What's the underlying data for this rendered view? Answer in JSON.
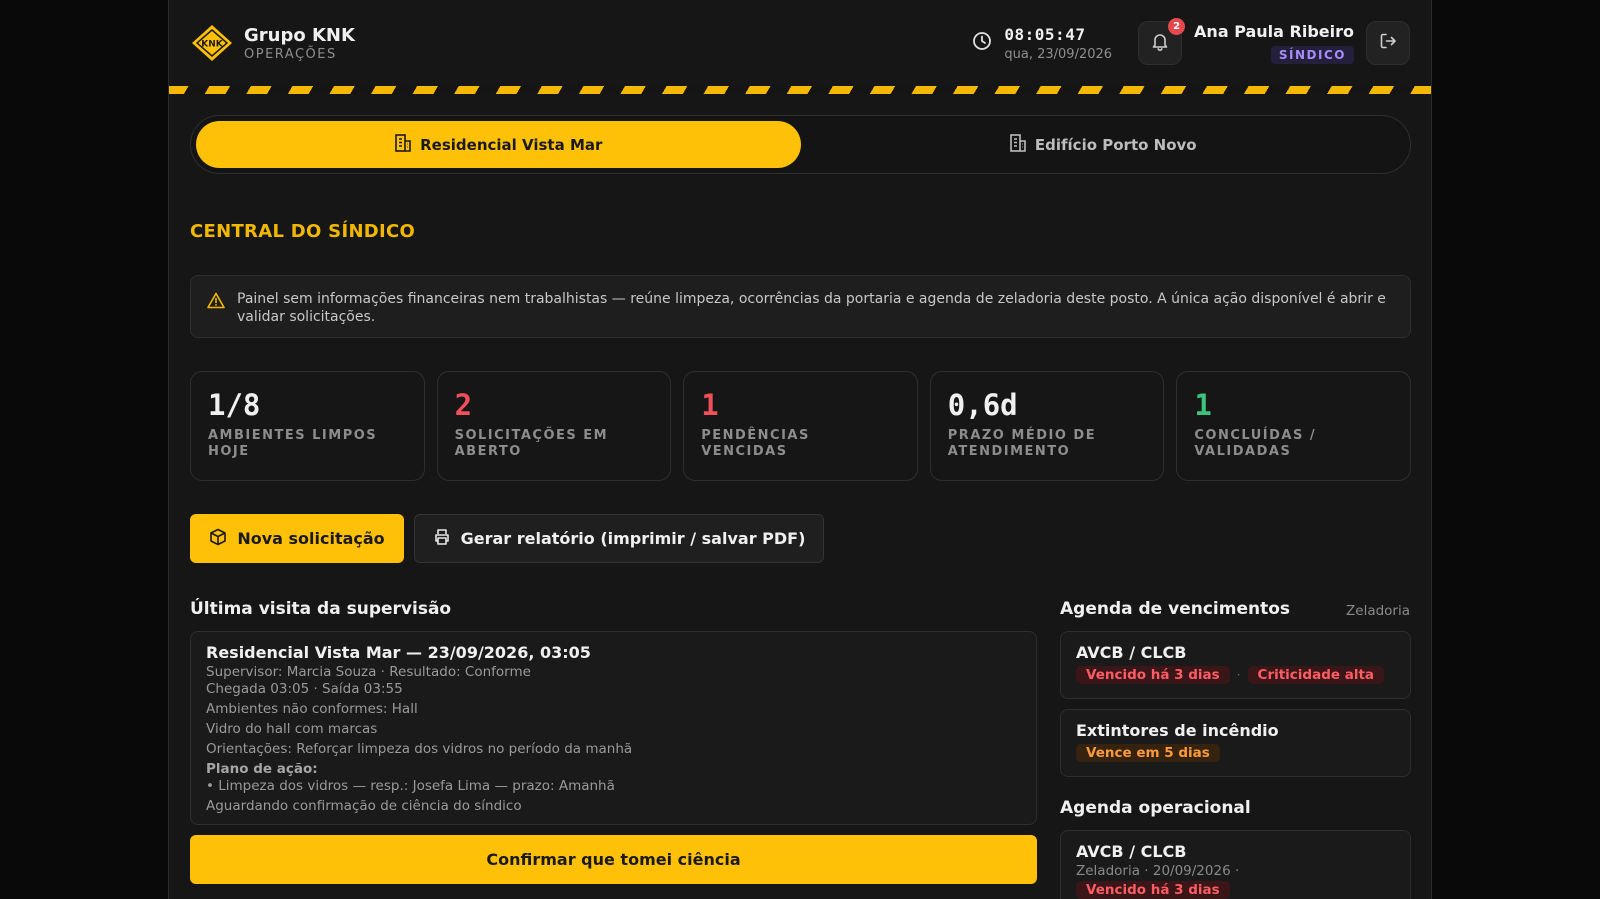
{
  "brand": {
    "name": "Grupo KNK",
    "subtitle": "OPERAÇÕES",
    "logo_text": "KNK",
    "accent": "#ffc107"
  },
  "clock": {
    "time": "08:05:47",
    "date": "qua, 23/09/2026"
  },
  "notifications": {
    "count": "2"
  },
  "user": {
    "name": "Ana Paula Ribeiro",
    "role": "SÍNDICO"
  },
  "tabs": [
    {
      "label": "Residencial Vista Mar",
      "active": true
    },
    {
      "label": "Edifício Porto Novo",
      "active": false
    }
  ],
  "section_title": "CENTRAL DO SÍNDICO",
  "notice": "Painel sem informações financeiras nem trabalhistas — reúne limpeza, ocorrências da portaria e agenda de zeladoria deste posto. A única ação disponível é abrir e validar solicitações.",
  "stats": [
    {
      "value": "1/8",
      "label": "AMBIENTES LIMPOS HOJE",
      "color": "#f0f0f0"
    },
    {
      "value": "2",
      "label": "SOLICITAÇÕES EM ABERTO",
      "color": "#f0505a"
    },
    {
      "value": "1",
      "label": "PENDÊNCIAS VENCIDAS",
      "color": "#f0505a"
    },
    {
      "value": "0,6d",
      "label": "PRAZO MÉDIO DE ATENDIMENTO",
      "color": "#f0f0f0"
    },
    {
      "value": "1",
      "label": "CONCLUÍDAS / VALIDADAS",
      "color": "#3cc47c"
    }
  ],
  "actions": {
    "new_request": "Nova solicitação",
    "report": "Gerar relatório (imprimir / salvar PDF)"
  },
  "last_visit": {
    "title": "Última visita da supervisão",
    "heading": "Residencial Vista Mar — 23/09/2026, 03:05",
    "supervisor_line": "Supervisor: Marcia Souza · Resultado: Conforme",
    "times_line": "Chegada 03:05 · Saída 03:55",
    "nonconform": "Ambientes não conformes: Hall",
    "observation": "Vidro do hall com marcas",
    "guidance": "Orientações: Reforçar limpeza dos vidros no período da manhã",
    "plan_label": "Plano de ação:",
    "plan_item": "• Limpeza dos vidros — resp.: Josefa Lima — prazo: Amanhã",
    "status": "Aguardando confirmação de ciência do síndico",
    "confirm_label": "Confirmar que tomei ciência"
  },
  "due_agenda": {
    "title": "Agenda de vencimentos",
    "side_label": "Zeladoria",
    "items": [
      {
        "title": "AVCB / CLCB",
        "tag1": "Vencido há 3 dias",
        "tag2": "Criticidade alta"
      },
      {
        "title": "Extintores de incêndio",
        "tag1": "Vence em 5 dias"
      }
    ]
  },
  "ops_agenda": {
    "title": "Agenda operacional",
    "items": [
      {
        "title": "AVCB / CLCB",
        "sub": "Zeladoria · 20/09/2026 ·",
        "tag": "Vencido há 3 dias"
      }
    ]
  }
}
